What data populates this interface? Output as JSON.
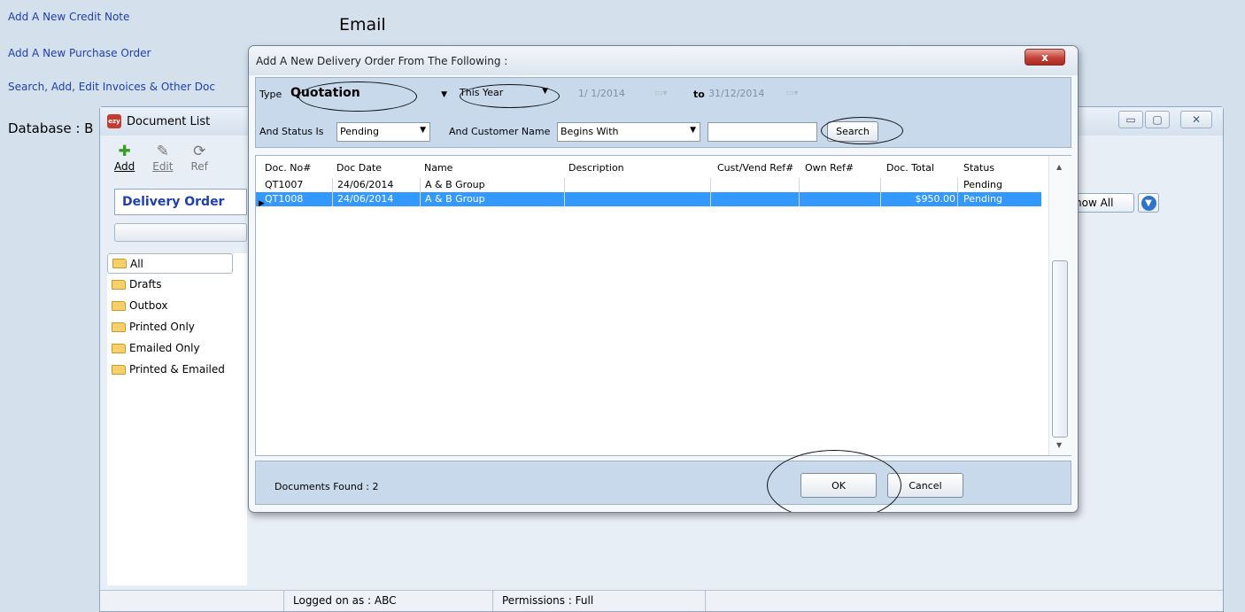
{
  "links": {
    "credit_note": "Add A New Credit Note",
    "purchase_order": "Add A New Purchase Order",
    "search_invoices": "Search, Add, Edit Invoices & Other Doc"
  },
  "email_heading": "Email",
  "database_label": "Database : B",
  "doclist": {
    "logo": "ezy",
    "title": "Document List",
    "toolbar": [
      {
        "label": "Add",
        "icon": "plus-icon"
      },
      {
        "label": "Edit",
        "icon": "pencil-icon"
      },
      {
        "label": "Ref",
        "icon": "refresh-icon"
      }
    ],
    "doc_type": "Delivery Order",
    "show_all": "how All",
    "folders": [
      "All",
      "Drafts",
      "Outbox",
      "Printed Only",
      "Emailed Only",
      "Printed & Emailed"
    ],
    "status": {
      "logged": "Logged on as : ABC",
      "permissions": "Permissions : Full"
    },
    "controls": {
      "minimize": "▭",
      "maximize": "▢",
      "close": "✕"
    }
  },
  "dialog": {
    "title": "Add A New Delivery Order From The Following :",
    "close": "x",
    "filters": {
      "type_label": "Type",
      "type_value": "Quotation",
      "period_value": "This Year",
      "date_from": "1/ 1/2014",
      "to_label": "to",
      "date_to": "31/12/2014",
      "status_label": "And Status Is",
      "status_value": "Pending",
      "customer_label": "And Customer Name",
      "customer_mode": "Begins With",
      "customer_value": "",
      "search_label": "Search"
    },
    "grid": {
      "columns": [
        "Doc. No#",
        "Doc Date",
        "Name",
        "Description",
        "Cust/Vend Ref#",
        "Own Ref#",
        "Doc. Total",
        "Status"
      ],
      "rows": [
        {
          "doc_no": "QT1007",
          "date": "24/06/2014",
          "name": "A & B Group",
          "description": "",
          "cust_ref": "",
          "own_ref": "",
          "total": "",
          "status": "Pending"
        },
        {
          "doc_no": "QT1008",
          "date": "24/06/2014",
          "name": "A & B Group",
          "description": "",
          "cust_ref": "",
          "own_ref": "",
          "total": "$950.00",
          "status": "Pending",
          "selected": true
        }
      ]
    },
    "docs_found": "Documents Found : 2",
    "ok_label": "OK",
    "cancel_label": "Cancel"
  },
  "colors": {
    "link": "#1f3faa",
    "selection": "#3399ff",
    "background": "#d4e0ec"
  }
}
